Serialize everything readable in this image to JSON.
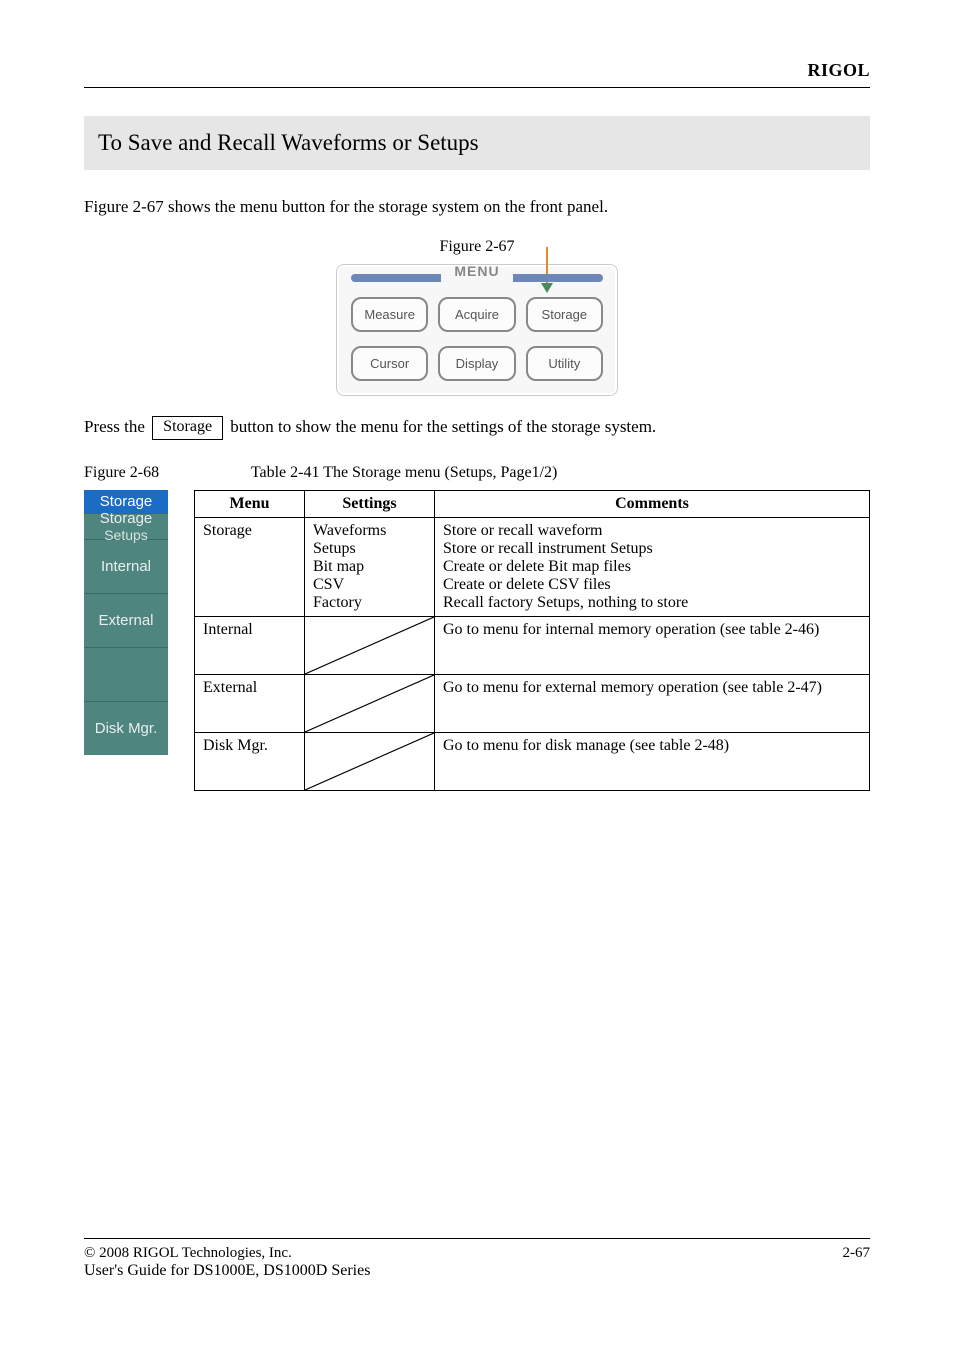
{
  "header": {
    "brand": "RIGOL"
  },
  "banner": "To Save and Recall Waveforms or Setups",
  "intro": "Figure 2-67 shows the menu button for the storage system on the front panel.",
  "figure": {
    "label": "Figure 2-67",
    "title": "MENU",
    "row1": [
      "Measure",
      "Acquire",
      "Storage"
    ],
    "row2": [
      "Cursor",
      "Display",
      "Utility"
    ]
  },
  "press": {
    "prefix": "Press the ",
    "button": "Storage",
    "suffix": " button to show the menu for the settings of the storage system."
  },
  "softmenu": {
    "header": "Storage",
    "items": [
      {
        "line1": "Storage",
        "line2": "Setups"
      },
      {
        "line1": "Internal"
      },
      {
        "line1": "External"
      },
      {
        "line1": ""
      },
      {
        "line1": "Disk Mgr."
      }
    ]
  },
  "table": {
    "caption_prefix": "Figure 2-68",
    "caption": "Table 2-41 The Storage menu (Setups, Page1/2)",
    "headers": [
      "Menu",
      "Settings",
      "Comments"
    ],
    "row_storage": {
      "menu": "Storage",
      "settings": [
        "Waveforms",
        "Setups",
        "Bit map",
        "CSV",
        "Factory"
      ],
      "comments": [
        "Store or recall waveform",
        "Store or recall instrument Setups",
        "Create or delete Bit map files",
        "Create or delete CSV files",
        "Recall factory Setups, nothing to store"
      ]
    },
    "row_internal": {
      "menu": "Internal",
      "comments": "Go to menu for internal memory operation (see table 2-46)"
    },
    "row_external": {
      "menu": "External",
      "comments": "Go to menu for external memory operation (see table 2-47)"
    },
    "row_disk": {
      "menu": "Disk Mgr.",
      "comments": "Go to menu for disk manage (see table 2-48)"
    }
  },
  "footer": {
    "copyright": "© 2008 RIGOL Technologies, Inc.",
    "guide": "User's Guide for DS1000E, DS1000D Series",
    "page": "2-67"
  }
}
